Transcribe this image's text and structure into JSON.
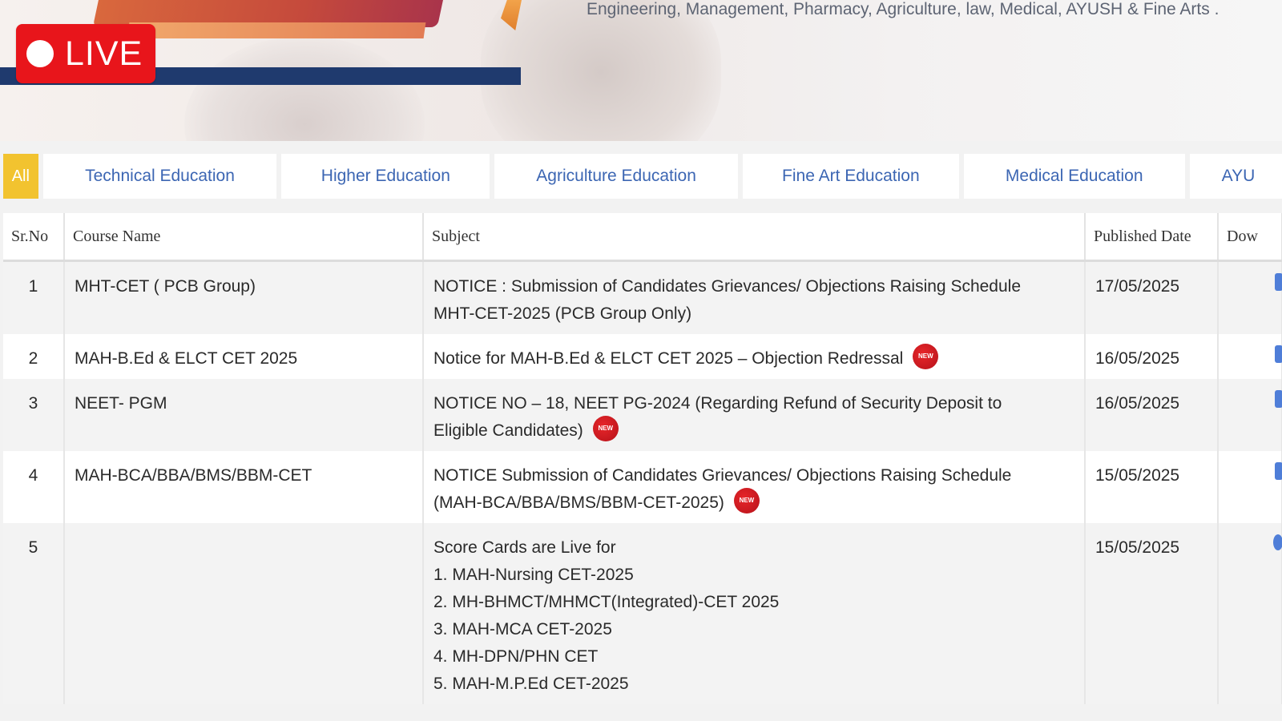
{
  "banner": {
    "tagline": "Engineering, Management, Pharmacy, Agriculture, law, Medical, AYUSH & Fine Arts .",
    "live_label": "LIVE"
  },
  "tabs": [
    {
      "label": "All",
      "active": true
    },
    {
      "label": "Technical Education"
    },
    {
      "label": "Higher Education"
    },
    {
      "label": "Agriculture Education"
    },
    {
      "label": "Fine Art Education"
    },
    {
      "label": "Medical Education"
    },
    {
      "label": "AYU"
    }
  ],
  "table": {
    "headers": {
      "sr": "Sr.No",
      "course": "Course Name",
      "subject": "Subject",
      "date": "Published Date",
      "download": "Dow"
    },
    "new_badge_text": "NEW",
    "rows": [
      {
        "sr": "1",
        "course": "MHT-CET ( PCB Group)",
        "subject_lines": [
          "NOTICE : Submission of Candidates Grievances/ Objections Raising Schedule",
          "MHT-CET-2025 (PCB Group Only)"
        ],
        "is_new": false,
        "date": "17/05/2025"
      },
      {
        "sr": "2",
        "course": "MAH-B.Ed & ELCT CET 2025",
        "subject_lines": [
          "Notice for MAH-B.Ed & ELCT CET 2025 – Objection Redressal"
        ],
        "is_new": true,
        "date": "16/05/2025"
      },
      {
        "sr": "3",
        "course": "NEET- PGM",
        "subject_lines": [
          "NOTICE NO – 18, NEET PG-2024 (Regarding Refund of Security Deposit to",
          "Eligible Candidates)"
        ],
        "is_new": true,
        "date": "16/05/2025"
      },
      {
        "sr": "4",
        "course": "MAH-BCA/BBA/BMS/BBM-CET",
        "subject_lines": [
          "NOTICE Submission of Candidates Grievances/ Objections Raising Schedule",
          "(MAH-BCA/BBA/BMS/BBM-CET-2025)"
        ],
        "is_new": true,
        "date": "15/05/2025"
      },
      {
        "sr": "5",
        "course": "",
        "subject_lines": [
          "Score Cards are Live for",
          "1. MAH-Nursing CET-2025",
          "2. MH-BHMCT/MHMCT(Integrated)-CET 2025",
          "3. MAH-MCA CET-2025",
          "4. MH-DPN/PHN CET",
          "5. MAH-M.P.Ed CET-2025"
        ],
        "is_new": false,
        "date": "15/05/2025"
      }
    ]
  },
  "colors": {
    "tab_active": "#f2c32f",
    "tab_text": "#3c66b3",
    "live_red": "#e8151b",
    "banner_bar": "#1f3a6e"
  }
}
